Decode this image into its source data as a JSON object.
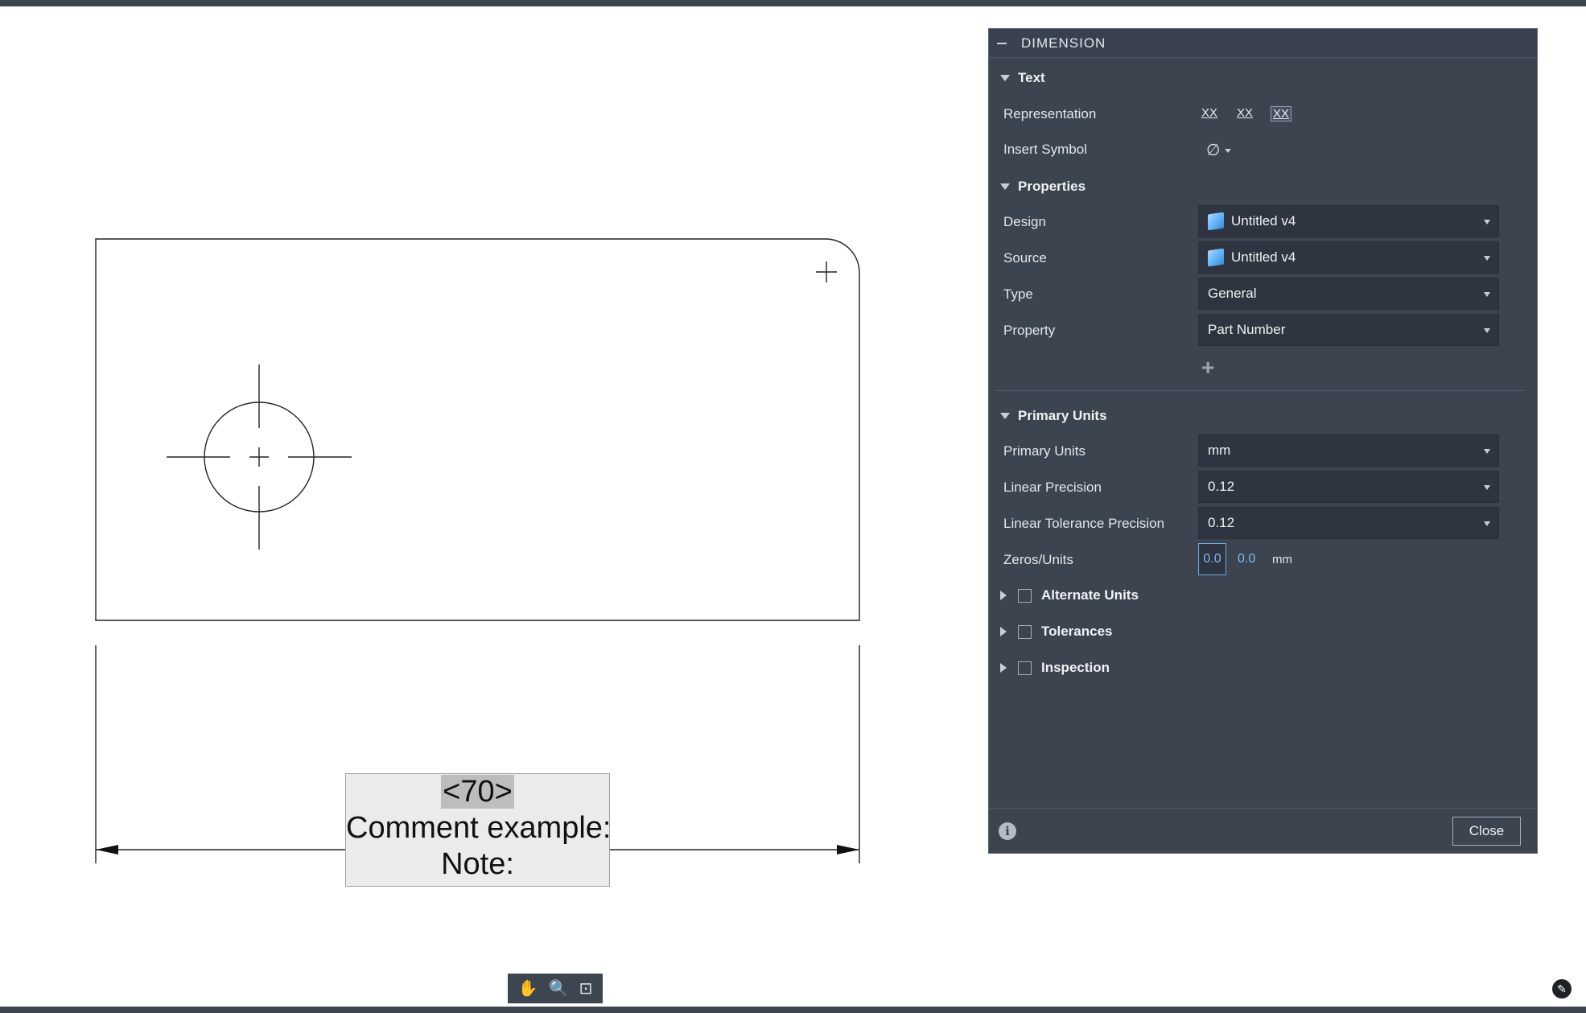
{
  "drawing": {
    "dimension_value": "<70>",
    "comment_line": "Comment example:",
    "note_line": "Note:"
  },
  "nav_bar": {
    "pan_icon": "✋",
    "zoom_icon": "🔍",
    "fit_icon": "⊡"
  },
  "panel": {
    "title": "DIMENSION",
    "sections": {
      "text": "Text",
      "properties": "Properties",
      "primary_units": "Primary Units",
      "alternate_units": "Alternate Units",
      "tolerances": "Tolerances",
      "inspection": "Inspection"
    },
    "labels": {
      "representation": "Representation",
      "insert_symbol": "Insert Symbol",
      "design": "Design",
      "source": "Source",
      "type": "Type",
      "property": "Property",
      "primary_units": "Primary Units",
      "linear_precision": "Linear Precision",
      "linear_tolerance_precision": "Linear Tolerance Precision",
      "zeros_units": "Zeros/Units"
    },
    "representation_options": [
      "XX",
      "XX",
      "XX"
    ],
    "insert_symbol_glyph": "∅",
    "values": {
      "design": "Untitled v4",
      "source": "Untitled v4",
      "type": "General",
      "property": "Part Number",
      "primary_units": "mm",
      "linear_precision": "0.12",
      "linear_tolerance_precision": "0.12",
      "zero_leading": "0.0",
      "zero_trailing": "0.0",
      "zero_unit": "mm"
    },
    "add_glyph": "+",
    "info_glyph": "i",
    "close_label": "Close"
  },
  "colors": {
    "panel_bg": "#3c4450",
    "dropdown_bg": "#2f3540",
    "accent_blue": "#7fb8f0",
    "chrome_bar": "#3d4550"
  }
}
